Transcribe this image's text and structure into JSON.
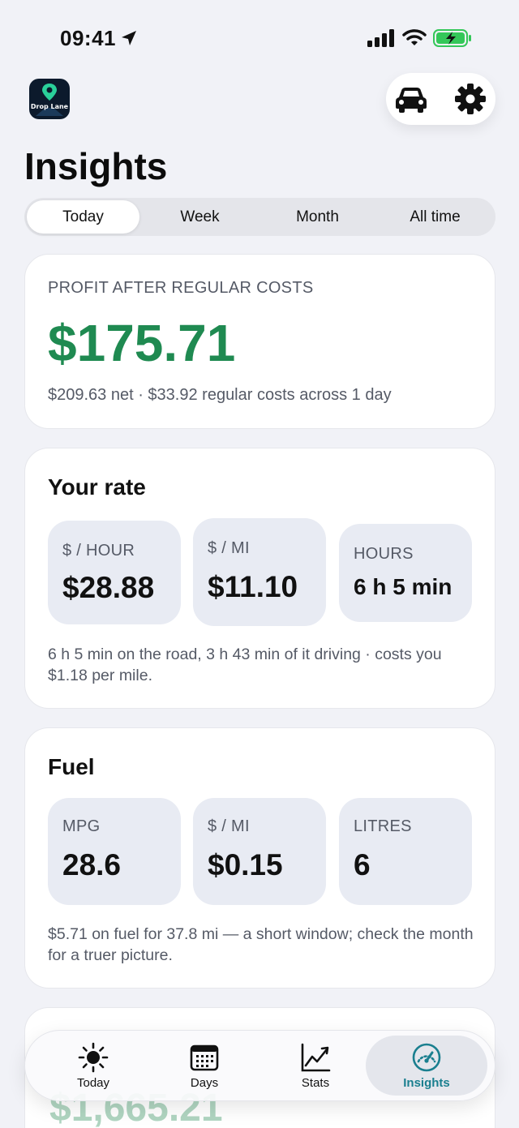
{
  "status": {
    "time": "09:41"
  },
  "header": {
    "title": "Insights"
  },
  "segments": [
    "Today",
    "Week",
    "Month",
    "All time"
  ],
  "profit": {
    "label": "PROFIT AFTER REGULAR COSTS",
    "value": "$175.71",
    "sub": "$209.63 net · $33.92 regular costs across 1 day"
  },
  "rate": {
    "title": "Your rate",
    "tiles": [
      {
        "label": "$ / HOUR",
        "value": "$28.88"
      },
      {
        "label": "$ / MI",
        "value": "$11.10"
      },
      {
        "label": "HOURS",
        "value": "6 h 5 min"
      }
    ],
    "note": "6 h 5 min on the road, 3 h 43 min of it driving · costs you $1.18 per mile."
  },
  "fuel": {
    "title": "Fuel",
    "tiles": [
      {
        "label": "MPG",
        "value": "28.6"
      },
      {
        "label": "$ / MI",
        "value": "$0.15"
      },
      {
        "label": "LITRES",
        "value": "6"
      }
    ],
    "note": "$5.71 on fuel for 37.8 mi — a short window; check the month for a truer picture."
  },
  "peek": {
    "value": "$1,665.21"
  },
  "tabs": [
    {
      "label": "Today",
      "icon": "sun-icon"
    },
    {
      "label": "Days",
      "icon": "calendar-icon"
    },
    {
      "label": "Stats",
      "icon": "chart-icon"
    },
    {
      "label": "Insights",
      "icon": "gauge-icon"
    }
  ],
  "colors": {
    "accent": "#1f8a51",
    "tab_active": "#1a7f8f",
    "background": "#f1f2f7"
  }
}
